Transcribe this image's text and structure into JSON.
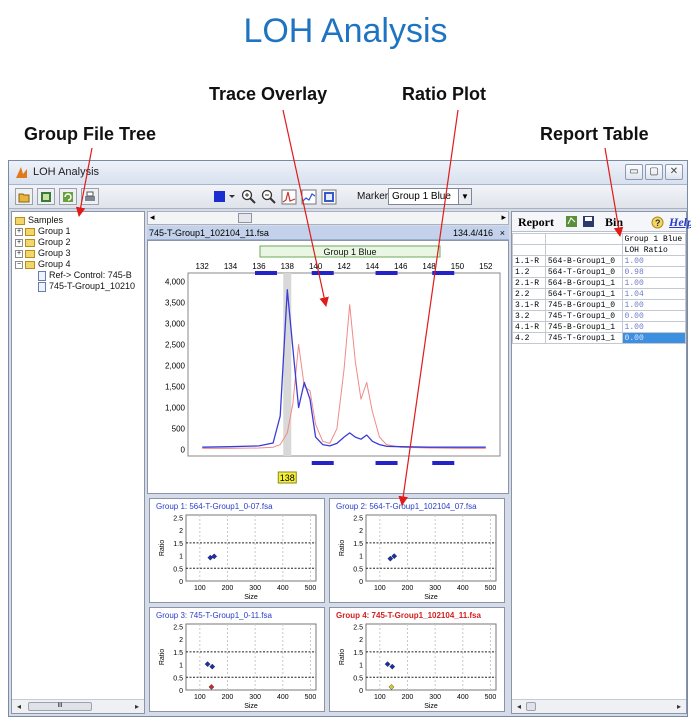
{
  "slide": {
    "title": "LOH Analysis",
    "callouts": {
      "tree": "Group File Tree",
      "trace": "Trace Overlay",
      "ratio": "Ratio Plot",
      "report": "Report Table"
    }
  },
  "window": {
    "title": "LOH Analysis",
    "min_glyph": "▭",
    "max_glyph": "▢",
    "close_glyph": "✕"
  },
  "toolbar": {
    "marker_label": "Marker:",
    "marker_value": "Group 1 Blue",
    "dropdown_glyph": "▼",
    "color_accent": "#1b2fd0"
  },
  "tree": {
    "root": "Samples",
    "groups": [
      "Group 1",
      "Group 2",
      "Group 3",
      "Group 4"
    ],
    "children": [
      "Ref-> Control: 745-B",
      "745-T-Group1_10210"
    ],
    "scroll_glyph": "III"
  },
  "trace": {
    "file": "745-T-Group1_102104_11.fsa",
    "range": "134.4/416",
    "close": "×",
    "marker_label": "Group 1 Blue",
    "selected_label": "138",
    "x_ticks": [
      132,
      134,
      136,
      138,
      140,
      142,
      144,
      146,
      148,
      150,
      152
    ],
    "y_ticks": [
      0,
      500,
      "1,000",
      "1,500",
      "2,000",
      "2,500",
      "3,000",
      "3,500",
      "4,000"
    ],
    "series_colors": {
      "tumor": "#3b3bd8",
      "control": "#f08a8a"
    }
  },
  "chart_data": {
    "type": "line",
    "x": [
      132,
      134,
      136,
      137,
      137.5,
      138,
      138.4,
      138.8,
      139.2,
      139.6,
      140,
      140.5,
      141,
      141.5,
      142,
      142.4,
      142.8,
      143.2,
      143.6,
      144,
      144.5,
      145,
      146,
      148,
      150,
      152
    ],
    "series": [
      {
        "values": [
          60,
          70,
          90,
          160,
          800,
          3800,
          2400,
          1000,
          1600,
          1200,
          300,
          120,
          90,
          150,
          300,
          400,
          300,
          250,
          350,
          200,
          120,
          80,
          70,
          60,
          60,
          60
        ]
      },
      {
        "values": [
          30,
          30,
          40,
          60,
          120,
          400,
          1100,
          2500,
          1500,
          1400,
          600,
          200,
          150,
          500,
          1900,
          3450,
          2100,
          1200,
          1600,
          900,
          300,
          120,
          60,
          40,
          30,
          30
        ]
      }
    ],
    "xlim": [
      131,
      153
    ],
    "ylim": [
      -150,
      4200
    ],
    "grid": false,
    "selected_bin": 138
  },
  "subplots": [
    {
      "title": "Group 1: 564-T-Group1_0-07.fsa",
      "title_color": "#2a3ec8",
      "points": [
        [
          138,
          0.92,
          "#1b2fa8"
        ],
        [
          152,
          0.97,
          "#1b2fa8"
        ]
      ]
    },
    {
      "title": "Group 2: 564-T-Group1_102104_07.fsa",
      "title_color": "#2a3ec8",
      "points": [
        [
          138,
          0.88,
          "#1b2fa8"
        ],
        [
          152,
          0.98,
          "#1b2fa8"
        ]
      ]
    },
    {
      "title": "Group 3: 745-T-Group1_0-11.fsa",
      "title_color": "#2a3ec8",
      "points": [
        [
          128,
          1.02,
          "#1b2fa8"
        ],
        [
          145,
          0.92,
          "#1b2fa8"
        ],
        [
          142,
          0.12,
          "#c8282a"
        ]
      ]
    },
    {
      "title": "Group 4: 745-T-Group1_102104_11.fsa",
      "title_color": "#d42020",
      "points": [
        [
          128,
          1.02,
          "#1b2fa8"
        ],
        [
          145,
          0.92,
          "#1b2fa8"
        ],
        [
          142,
          0.12,
          "#d6c630"
        ]
      ]
    }
  ],
  "subplot_axes": {
    "xlabel": "Size",
    "ylabel": "Ratio",
    "x_ticks": [
      100,
      200,
      300,
      400,
      500
    ],
    "y_ticks": [
      0,
      0.5,
      1,
      1.5,
      2,
      2.5
    ],
    "xlim": [
      50,
      520
    ],
    "ylim": [
      0,
      2.6
    ],
    "thresholds": [
      0.5,
      1.5
    ]
  },
  "report": {
    "title": "Report",
    "bin_label": "Bin",
    "help_label": "Help",
    "col_header": "Group 1 Blue",
    "col_sub": "LOH Ratio",
    "rows": [
      [
        "1.1-R",
        "564-B-Group1_0",
        "1.00"
      ],
      [
        "1.2",
        "564-T-Group1_0",
        "0.98"
      ],
      [
        "2.1-R",
        "564-B-Group1_1",
        "1.00"
      ],
      [
        "2.2",
        "564-T-Group1_1",
        "1.04"
      ],
      [
        "3.1-R",
        "745-B-Group1_0",
        "1.00"
      ],
      [
        "3.2",
        "745-T-Group1_0",
        "0.00"
      ],
      [
        "4.1-R",
        "745-B-Group1_1",
        "1.00"
      ],
      [
        "4.2",
        "745-T-Group1_1",
        "0.00"
      ]
    ],
    "selected_row": 7
  }
}
